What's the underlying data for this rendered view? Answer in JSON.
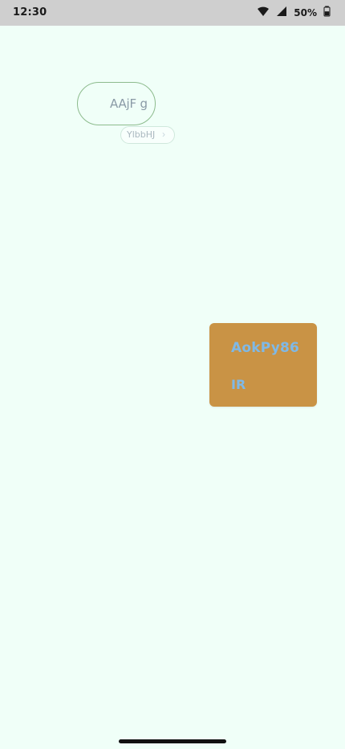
{
  "status_bar": {
    "time": "12:30",
    "battery": "50%",
    "icons": [
      "wifi-icon",
      "signal-icon",
      "battery-icon"
    ]
  },
  "pill": {
    "label": "AAjF g"
  },
  "chip": {
    "label": "YlbbHJ",
    "icon": "chevron-right-icon"
  },
  "card": {
    "title": "AokPy86",
    "subtitle": "IR",
    "background_color": "#c99345",
    "text_color": "#7fb9e7"
  }
}
